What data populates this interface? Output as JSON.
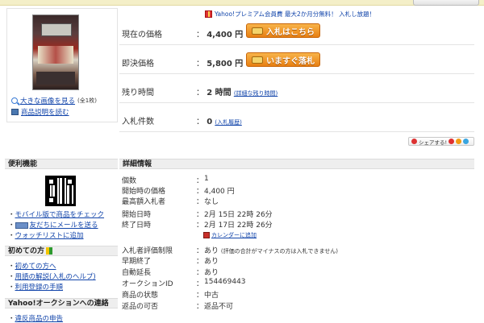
{
  "premium_banner": "Yahoo!プレミアム会員費 最大2か月分無料！ 入札し放題！",
  "image_panel": {
    "enlarge_link": "大きな画像を見る",
    "enlarge_count": "(全1枚)",
    "description_link": "商品説明を読む"
  },
  "price": {
    "current_label": "現在の価格",
    "current_value": "4,400 円",
    "bid_button": "入札はこちら",
    "buynow_label": "即決価格",
    "buynow_value": "5,800 円",
    "buynow_button": "いますぐ落札",
    "time_label": "残り時間",
    "time_value": "2 時間",
    "time_detail_link": "(詳細な残り時間)",
    "bids_label": "入札件数",
    "bids_value": "0",
    "bids_history_link": "(入札履歴)"
  },
  "share": {
    "label": "シェアする!"
  },
  "sidebar": {
    "convenient_title": "便利機能",
    "mobile_link": "モバイル版で商品をチェック",
    "mail_link": "友だちにメールを送る",
    "watchlist_link": "ウォッチリストに追加",
    "beginner_title": "初めての方",
    "beginner_links": [
      "初めての方へ",
      "用語の解説(入札のヘルプ)",
      "利用登録の手順"
    ],
    "contact_title": "Yahoo!オークションへの連絡",
    "report_link": "違反商品の申告"
  },
  "details": {
    "title": "詳細情報",
    "colon": "：",
    "rows": [
      {
        "label": "個数",
        "value": "1"
      },
      {
        "label": "開始時の価格",
        "value": "4,400 円"
      },
      {
        "label": "最高額入札者",
        "value": "なし"
      },
      {
        "label": "開始日時",
        "value": "2月 15日 22時 26分"
      },
      {
        "label": "終了日時",
        "value": "2月 17日 22時 26分"
      },
      {
        "label": "入札者評価制限",
        "value": "あり",
        "note": "(評価の合計がマイナスの方は入札できません)"
      },
      {
        "label": "早期終了",
        "value": "あり"
      },
      {
        "label": "自動延長",
        "value": "あり"
      },
      {
        "label": "オークションID",
        "value": "154469443"
      },
      {
        "label": "商品の状態",
        "value": "中古"
      },
      {
        "label": "返品の可否",
        "value": "返品不可"
      }
    ],
    "calendar_link": "カレンダーに追加"
  }
}
